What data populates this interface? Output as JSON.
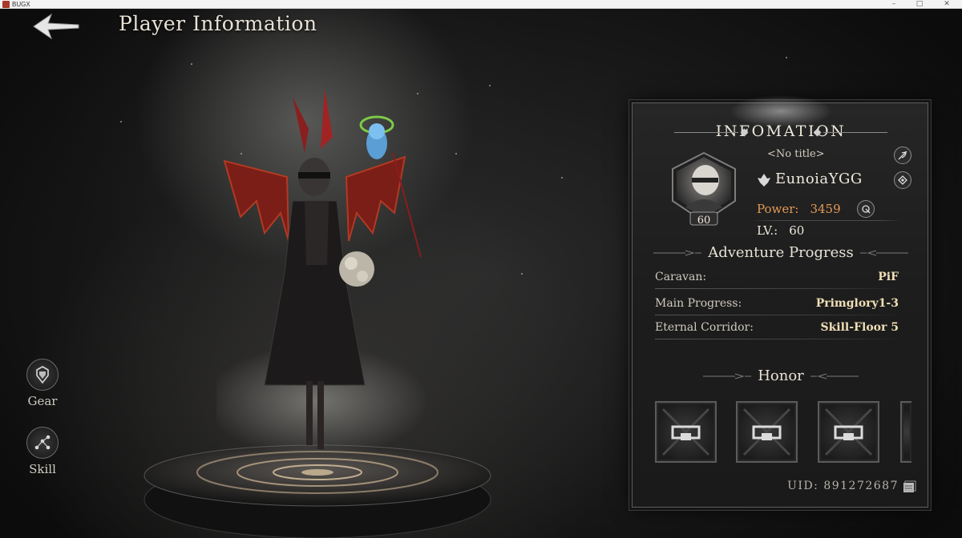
{
  "window": {
    "title": "BUGX"
  },
  "header": {
    "title": "Player Information"
  },
  "side_menu": [
    {
      "label": "Gear",
      "icon": "gear-armor-icon"
    },
    {
      "label": "Skill",
      "icon": "skill-constellation-icon"
    }
  ],
  "info": {
    "heading": "INFOMATION",
    "player": {
      "title": "<No title>",
      "name": "EunoiaYGG",
      "level_badge": "60",
      "power_label": "Power:",
      "power_value": "3459",
      "lv_label": "LV.:",
      "lv_value": "60"
    },
    "adventure": {
      "heading": "Adventure Progress",
      "rows": [
        {
          "label": "Caravan:",
          "value": "PiF"
        },
        {
          "label": "Main Progress:",
          "value": "Primglory1-3"
        },
        {
          "label": "Eternal Corridor:",
          "value": "Skill-Floor 5"
        }
      ]
    },
    "honor": {
      "heading": "Honor"
    },
    "uid": "UID: 891272687"
  },
  "colors": {
    "power": "#e39a55",
    "accent_value": "#f0dfb6",
    "panel_border": "#5d5d5d"
  }
}
